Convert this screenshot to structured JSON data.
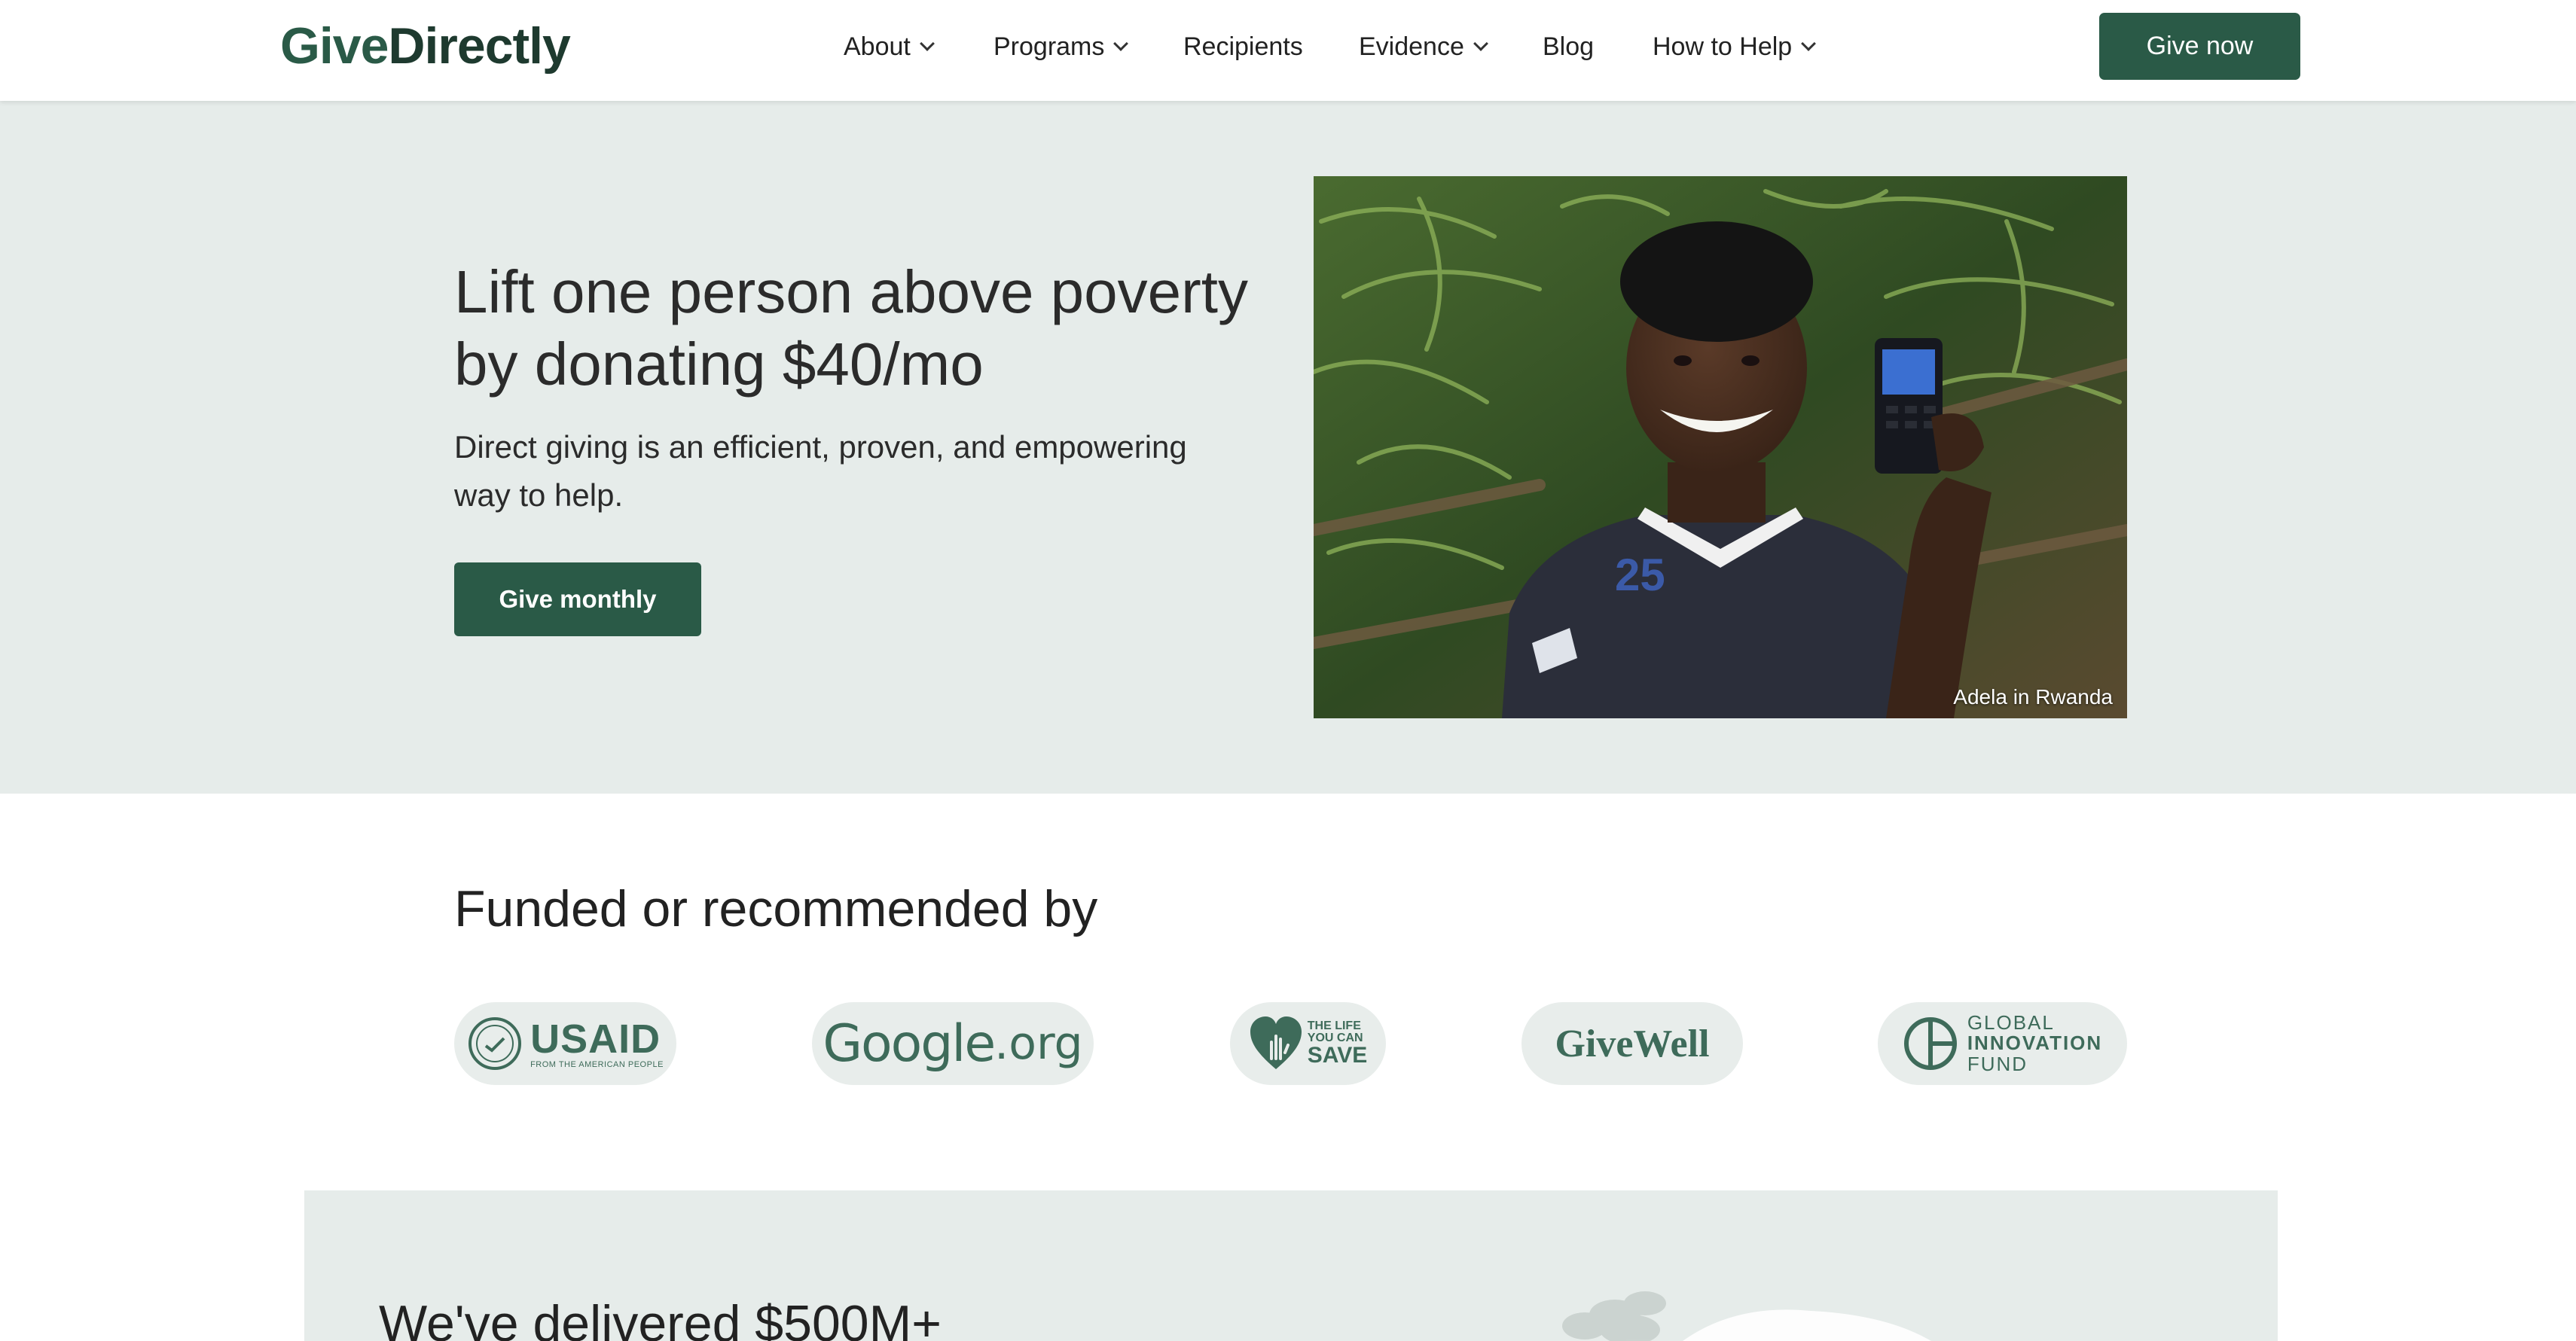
{
  "header": {
    "logo_give": "Give",
    "logo_directly": "Directly",
    "nav": [
      {
        "label": "About",
        "dropdown": true
      },
      {
        "label": "Programs",
        "dropdown": true
      },
      {
        "label": "Recipients",
        "dropdown": false
      },
      {
        "label": "Evidence",
        "dropdown": true
      },
      {
        "label": "Blog",
        "dropdown": false
      },
      {
        "label": "How to Help",
        "dropdown": true
      }
    ],
    "cta_label": "Give now"
  },
  "hero": {
    "title": "Lift one person above poverty by donating $40/mo",
    "subtitle": "Direct giving is an efficient, proven, and empowering way to help.",
    "cta_label": "Give monthly",
    "photo_caption": "Adela in Rwanda"
  },
  "funders": {
    "title": "Funded or recommended by",
    "logos": {
      "usaid": {
        "name": "USAID",
        "tagline": "FROM THE AMERICAN PEOPLE"
      },
      "google": {
        "name": "Google",
        "suffix": ".org"
      },
      "tlycs": {
        "line1": "THE LIFE",
        "line2": "YOU CAN",
        "line3": "SAVE"
      },
      "givewell": {
        "name": "GiveWell"
      },
      "gif": {
        "line1": "GLOBAL",
        "line2": "INNOVATION",
        "line3": "FUND"
      }
    }
  },
  "delivered": {
    "title": "We've delivered $500M+"
  },
  "colors": {
    "brand_green": "#2a5a47",
    "hero_bg": "#e6ecea",
    "logo_pill_bg": "#e8edeb",
    "logo_green": "#3e6b5a"
  }
}
